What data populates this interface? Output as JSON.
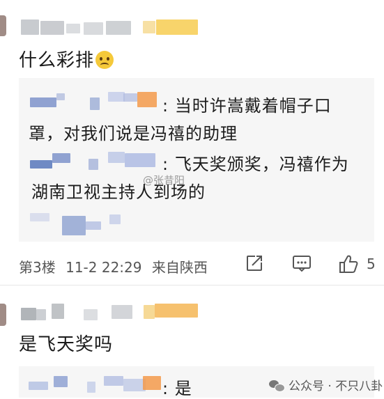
{
  "comment1": {
    "text": "什么彩排",
    "emoji": "🙁",
    "replies": [
      {
        "prefix": ":",
        "text_line1": "当时许嵩戴着帽子口",
        "text_line2": "罩，对我们说是冯禧的助理"
      },
      {
        "prefix": ":",
        "text_line1": "飞天奖颁奖，冯禧作为",
        "text_line2": "湖南卫视主持人到场的"
      }
    ],
    "meta": {
      "floor": "第3楼",
      "date": "11-2 22:29",
      "location": "来自陕西"
    },
    "like_count": "5",
    "watermark_inline": "@张昔阳"
  },
  "comment2": {
    "text": "是飞天奖吗",
    "reply": {
      "prefix": ":",
      "text": "是"
    }
  },
  "watermark": {
    "icon": "wechat-icon",
    "text": "公众号 · 不只八卦"
  },
  "colors": {
    "badge_orange": "#f39a4b",
    "badge_yellow": "#f6c53a",
    "reply_bg": "#f6f6f6",
    "meta_gray": "#555555"
  }
}
